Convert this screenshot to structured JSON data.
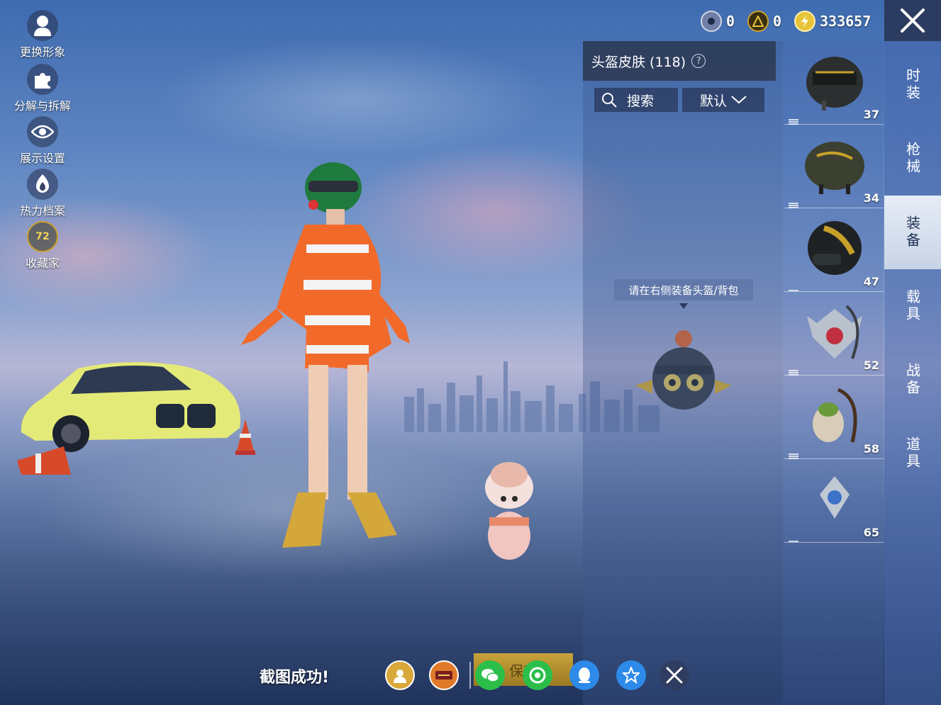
{
  "left_menu": [
    {
      "label": "更换形象",
      "icon": "avatar-icon"
    },
    {
      "label": "分解与拆解",
      "icon": "puzzle-icon"
    },
    {
      "label": "展示设置",
      "icon": "eye-icon"
    },
    {
      "label": "热力档案",
      "icon": "flame-icon"
    },
    {
      "label": "收藏家",
      "icon": "collector-badge-icon",
      "badge": "72"
    }
  ],
  "currency": [
    {
      "icon": "silver-coin-icon",
      "value": "0",
      "color": "#6f7ea6"
    },
    {
      "icon": "ag-coin-icon",
      "value": "0",
      "color": "#c9a12a"
    },
    {
      "icon": "bp-coin-icon",
      "value": "333657",
      "color": "#e8c43a"
    }
  ],
  "tabs": [
    {
      "label": "时装",
      "active": false
    },
    {
      "label": "枪械",
      "active": false
    },
    {
      "label": "装备",
      "active": true
    },
    {
      "label": "载具",
      "active": false
    },
    {
      "label": "战备",
      "active": false
    },
    {
      "label": "道具",
      "active": false
    }
  ],
  "items": [
    {
      "count": "37",
      "icon": "level3-helmet-icon"
    },
    {
      "count": "34",
      "icon": "camo-helmet-icon"
    },
    {
      "count": "47",
      "icon": "moto-helmet-icon"
    },
    {
      "count": "52",
      "icon": "wing-backpack-icon"
    },
    {
      "count": "58",
      "icon": "plush-backpack-icon"
    },
    {
      "count": "65",
      "icon": "pendant-icon"
    }
  ],
  "skin_panel": {
    "title": "头盔皮肤 (118)",
    "help": "?",
    "search_label": "搜索",
    "sort_label": "默认",
    "hint": "请在右侧装备头盔/背包"
  },
  "bottom": {
    "toast": "截图成功!",
    "save_label": "保存",
    "share": [
      {
        "icon": "profile-share-icon",
        "color": "#d8a83a"
      },
      {
        "icon": "game-logo-icon",
        "color": "#e07a2a"
      },
      {
        "icon": "wechat-icon",
        "color": "#2bbf4a"
      },
      {
        "icon": "moments-icon",
        "color": "#2bbf4a"
      },
      {
        "icon": "qq-icon",
        "color": "#2d8ae8"
      },
      {
        "icon": "qzone-icon",
        "color": "#2d8ae8"
      },
      {
        "icon": "close-share-icon",
        "color": "#2f3d60"
      }
    ]
  }
}
